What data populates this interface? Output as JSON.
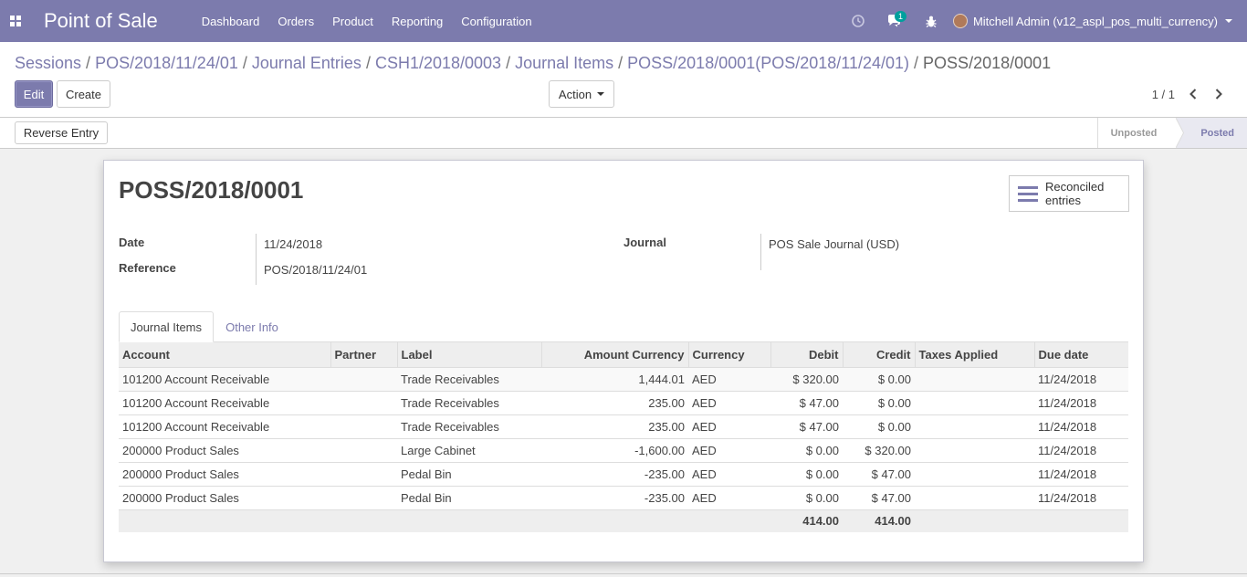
{
  "navbar": {
    "apps_icon": "apps-grid-icon",
    "brand": "Point of Sale",
    "menu": [
      "Dashboard",
      "Orders",
      "Product",
      "Reporting",
      "Configuration"
    ],
    "chat_badge": "1",
    "user": "Mitchell Admin (v12_aspl_pos_multi_currency)",
    "colors": {
      "brand_bg": "#7c7bad",
      "badge_bg": "#00a09d"
    }
  },
  "breadcrumb": {
    "links": [
      "Sessions",
      "POS/2018/11/24/01",
      "Journal Entries",
      "CSH1/2018/0003",
      "Journal Items",
      "POSS/2018/0001(POS/2018/11/24/01)"
    ],
    "separator": "/",
    "current": "POSS/2018/0001"
  },
  "toolbar": {
    "edit": "Edit",
    "create": "Create",
    "action": "Action",
    "pager": "1 / 1"
  },
  "statusbar": {
    "reverse_entry": "Reverse Entry",
    "steps": [
      "Unposted",
      "Posted"
    ],
    "active_step": "Posted"
  },
  "sheet": {
    "title": "POSS/2018/0001",
    "smart_button": {
      "line1": "Reconciled",
      "line2": "entries",
      "icon": "list-icon"
    },
    "fields": {
      "date_label": "Date",
      "date_value": "11/24/2018",
      "reference_label": "Reference",
      "reference_value": "POS/2018/11/24/01",
      "journal_label": "Journal",
      "journal_value": "POS Sale Journal (USD)"
    },
    "tabs": [
      "Journal Items",
      "Other Info"
    ],
    "active_tab": "Journal Items"
  },
  "table": {
    "columns": [
      "Account",
      "Partner",
      "Label",
      "Amount Currency",
      "Currency",
      "Debit",
      "Credit",
      "Taxes Applied",
      "Due date"
    ],
    "rows": [
      [
        "101200 Account Receivable",
        "",
        "Trade Receivables",
        "1,444.01",
        "AED",
        "$ 320.00",
        "$ 0.00",
        "",
        "11/24/2018"
      ],
      [
        "101200 Account Receivable",
        "",
        "Trade Receivables",
        "235.00",
        "AED",
        "$ 47.00",
        "$ 0.00",
        "",
        "11/24/2018"
      ],
      [
        "101200 Account Receivable",
        "",
        "Trade Receivables",
        "235.00",
        "AED",
        "$ 47.00",
        "$ 0.00",
        "",
        "11/24/2018"
      ],
      [
        "200000 Product Sales",
        "",
        "Large Cabinet",
        "-1,600.00",
        "AED",
        "$ 0.00",
        "$ 320.00",
        "",
        "11/24/2018"
      ],
      [
        "200000 Product Sales",
        "",
        "Pedal Bin",
        "-235.00",
        "AED",
        "$ 0.00",
        "$ 47.00",
        "",
        "11/24/2018"
      ],
      [
        "200000 Product Sales",
        "",
        "Pedal Bin",
        "-235.00",
        "AED",
        "$ 0.00",
        "$ 47.00",
        "",
        "11/24/2018"
      ]
    ],
    "totals": {
      "debit": "414.00",
      "credit": "414.00"
    }
  }
}
